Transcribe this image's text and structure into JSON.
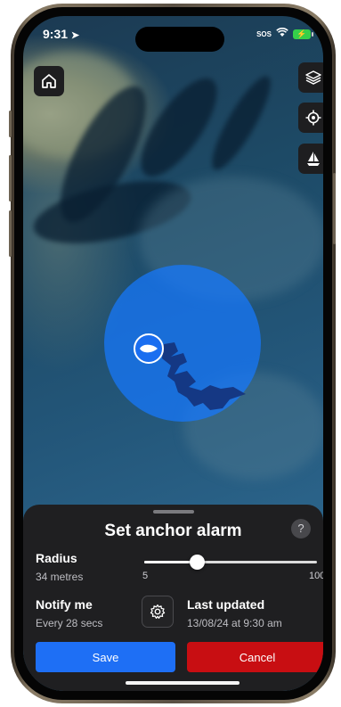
{
  "status_bar": {
    "time": "9:31",
    "sos": "SOS",
    "battery_icon": "battery-charging-icon"
  },
  "map_controls": {
    "home_icon": "home-icon",
    "layers_icon": "layers-icon",
    "locate_icon": "locate-icon",
    "boat_icon": "sailboat-icon"
  },
  "anchor_sheet": {
    "title": "Set anchor alarm",
    "help_label": "?",
    "radius_label": "Radius",
    "radius_value": "34 metres",
    "slider": {
      "min_label": "5",
      "max_label": "100",
      "min": 5,
      "max": 100,
      "value": 34
    },
    "notify_label": "Notify me",
    "notify_value": "Every 28 secs",
    "settings_icon": "gear-icon",
    "last_updated_label": "Last updated",
    "last_updated_value": "13/08/24 at 9:30 am",
    "save_label": "Save",
    "cancel_label": "Cancel"
  },
  "colors": {
    "accent": "#1e6ff5",
    "danger": "#c80e12",
    "radius_fill": "#1678ff",
    "sheet_bg": "#1f1f21"
  }
}
